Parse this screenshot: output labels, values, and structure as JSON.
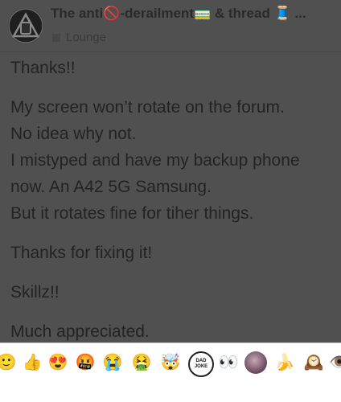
{
  "topic": {
    "title_prefix": "The anti",
    "title_emoji1": "🚫",
    "title_mid": "-derailment",
    "title_emoji2": "🚃",
    "title_suffix": " & thread ",
    "title_emoji3": "🧵",
    "title_ellipsis": " ...",
    "category": "Lounge"
  },
  "post": {
    "paragraphs": [
      "Thanks!!",
      "My screen won’t rotate on the forum.\nNo idea why not.\nI mistyped and have my backup phone now. An A42 5G Samsung.\nBut it rotates fine for tiher things.",
      "Thanks for fixing it!",
      "Skillz!!",
      "Much appreciated."
    ]
  },
  "reactions": [
    {
      "icon": "slightly-smiling-face-icon",
      "glyph": "🙂"
    },
    {
      "icon": "thumbs-up-icon",
      "glyph": "👍"
    },
    {
      "icon": "heart-eyes-icon",
      "glyph": "😍"
    },
    {
      "icon": "swearing-face-icon",
      "glyph": "🤬"
    },
    {
      "icon": "crying-face-icon",
      "glyph": "😭"
    },
    {
      "icon": "vomiting-face-icon",
      "glyph": "🤮"
    },
    {
      "icon": "exploding-head-icon",
      "glyph": "🤯"
    },
    {
      "icon": "dad-joke-icon",
      "glyph": "",
      "text": "DAD JOKE"
    },
    {
      "icon": "eyes-icon",
      "glyph": "👀"
    },
    {
      "icon": "avatar-reaction-icon",
      "glyph": ""
    },
    {
      "icon": "banana-icon",
      "glyph": "🍌"
    },
    {
      "icon": "clock-face-icon",
      "glyph": "🕰️"
    },
    {
      "icon": "eye-icon",
      "glyph": "👁️"
    }
  ]
}
